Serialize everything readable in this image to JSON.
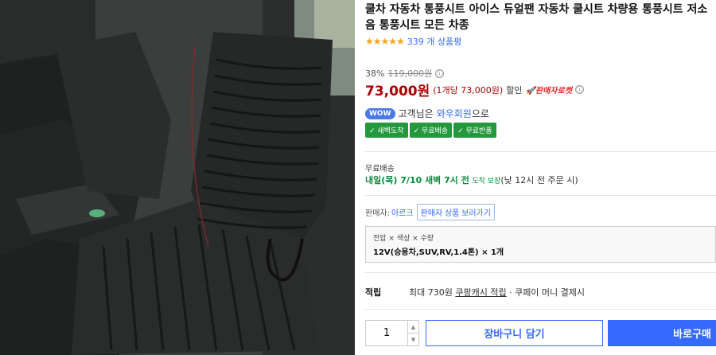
{
  "product": {
    "title": "쿨차 자동차 통풍시트 아이스 듀얼팬 자동차 쿨시트 차량용 통풍시트 저소음 통풍시트 모든 차종",
    "stars": "★★★★★",
    "review_count": "339 개 상품평",
    "rating": 4.5
  },
  "price": {
    "discount_rate": "38%",
    "original": "119,000원",
    "original_info_icon": "ⓘ",
    "sale": "73,000원",
    "unit_price": "(1개당 73,000원)",
    "sale_label": "할인",
    "rocket_label": "🚀판매자로켓",
    "rocket_info_icon": "ⓘ"
  },
  "wow": {
    "badge": "WOW",
    "prefix": "고객님은",
    "member": "와우회원",
    "suffix": "으로",
    "benefits": [
      "✓ 새벽도착",
      "✓ 무료배송",
      "✓ 무료반품"
    ]
  },
  "shipping": {
    "label": "무료배송",
    "date": "내일(목) 7/10 새벽 7시 전",
    "guarantee": "도착 보장",
    "note": "(낮 12시 전 주문 시)"
  },
  "seller": {
    "label": "판매자:",
    "name": "아르크",
    "button": "판매자 상품 보러가기"
  },
  "option": {
    "header": "전압 × 색상 × 수량",
    "value": "12V(승용차,SUV,RV,1.4톤) × 1개"
  },
  "points": {
    "label": "적립",
    "text_a": "최대 730원",
    "link": "쿠팡캐시 적립",
    "text_b": "· 쿠페이 머니 결제시"
  },
  "purchase": {
    "quantity": "1",
    "up": "▲",
    "down": "▼",
    "cart_label": "장바구니 담기",
    "buy_label": "바로구매"
  },
  "colors": {
    "accent": "#346aff",
    "price": "#ae0000",
    "benefit_green": "#24983c",
    "shipping_green": "#0a8a3a"
  }
}
